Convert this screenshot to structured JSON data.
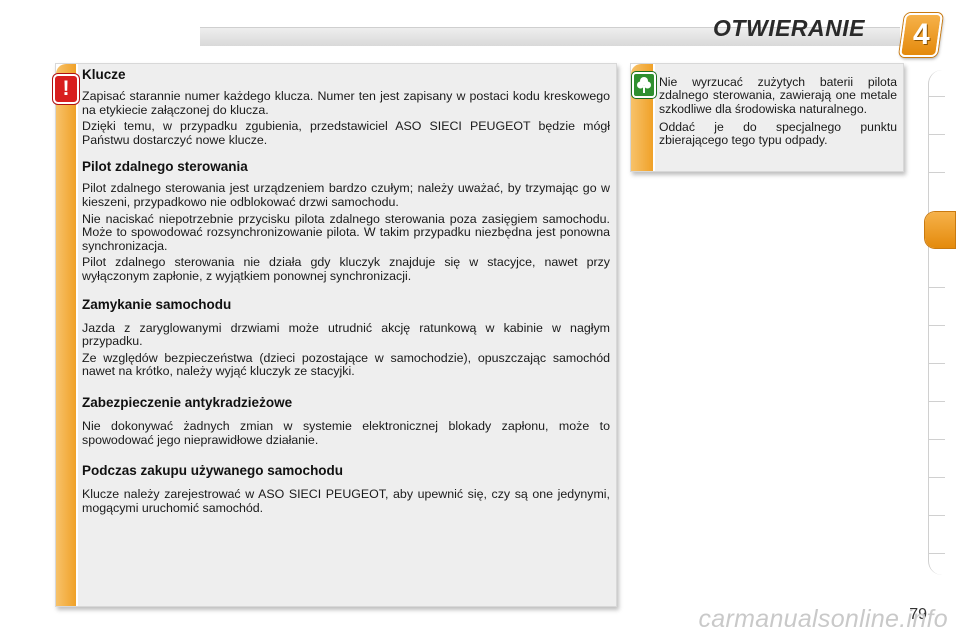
{
  "header": {
    "title": "OTWIERANIE",
    "chapter_number": "4"
  },
  "sections": [
    {
      "title": "Klucze",
      "paragraphs": [
        "Zapisać starannie numer każdego klucza. Numer ten jest zapisany w postaci kodu kreskowego na etykiecie załączonej do klucza.",
        "Dzięki temu, w przypadku zgubienia, przedstawiciel ASO SIECI PEUGEOT będzie mógł Państwu dostarczyć nowe klucze."
      ]
    },
    {
      "title": "Pilot zdalnego sterowania",
      "paragraphs": [
        "Pilot zdalnego sterowania jest urządzeniem bardzo czułym; należy uważać, by trzymając go w kieszeni, przypadkowo nie odblokować drzwi samochodu.",
        "Nie naciskać niepotrzebnie przycisku pilota zdalnego sterowania poza zasięgiem samochodu. Może to spowodować rozsynchronizowanie pilota. W takim przypadku niezbędna jest ponowna synchronizacja.",
        "Pilot zdalnego sterowania nie działa gdy kluczyk znajduje się w stacyjce, nawet przy wyłączonym zapłonie, z wyjątkiem ponownej synchronizacji."
      ]
    },
    {
      "title": "Zamykanie samochodu",
      "paragraphs": [
        "Jazda z zaryglowanymi drzwiami może utrudnić akcję ratunkową w kabinie w nagłym przypadku.",
        "Ze względów bezpieczeństwa (dzieci pozostające w samochodzie), opuszczając samochód nawet na krótko, należy wyjąć kluczyk ze stacyjki."
      ]
    },
    {
      "title": "Zabezpieczenie antykradzieżowe",
      "paragraphs": [
        "Nie dokonywać żadnych zmian w systemie elektronicznej blokady zapłonu, może to spowodować jego nieprawidłowe działanie."
      ]
    },
    {
      "title": "Podczas zakupu używanego samochodu",
      "paragraphs": [
        "Klucze należy zarejestrować w ASO SIECI PEUGEOT, aby upewnić się, czy są one jedynymi, mogącymi uruchomić samochód."
      ]
    }
  ],
  "note": {
    "paragraphs": [
      "Nie wyrzucać zużytych baterii pilota zdalnego sterowania, zawierają one metale szkodliwe dla środowiska naturalnego.",
      "Oddać je do specjalnego punktu zbierającego tego typu odpady."
    ]
  },
  "icons": {
    "warning": "warning-icon",
    "environment": "tree-icon"
  },
  "accent_color": "#f0a128",
  "page_number": "79",
  "watermark": "carmanualsonline.info"
}
